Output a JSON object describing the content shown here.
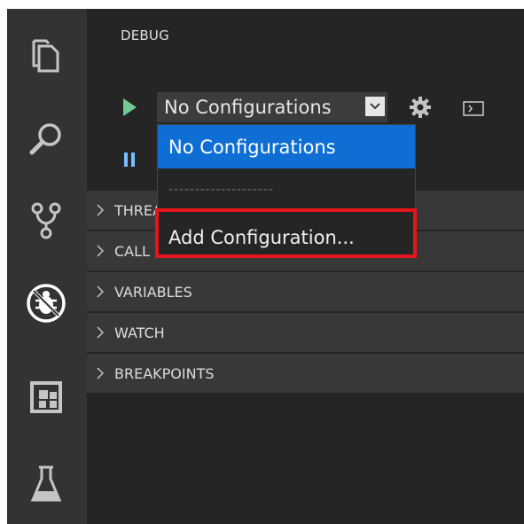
{
  "sidebar": {
    "title": "DEBUG",
    "toolbar": {
      "start_icon": "play-icon",
      "configuration_selected": "No Configurations",
      "settings_icon": "gear-icon",
      "console_icon": "terminal-icon",
      "pause_icon": "pause-icon"
    },
    "sections": [
      {
        "label": "THREADS"
      },
      {
        "label": "CALL STACK"
      },
      {
        "label": "VARIABLES"
      },
      {
        "label": "WATCH"
      },
      {
        "label": "BREAKPOINTS"
      }
    ]
  },
  "dropdown": {
    "options": [
      {
        "label": "No Configurations",
        "selected": true
      },
      {
        "label": "--------------------",
        "separator": true
      },
      {
        "label": "Add Configuration..."
      }
    ]
  },
  "activity_bar": {
    "icons": [
      "files-icon",
      "search-icon",
      "source-control-icon",
      "debug-icon",
      "extensions-icon",
      "flask-icon"
    ]
  },
  "colors": {
    "highlight": "#e8141c",
    "selection": "#0e6ed3",
    "play": "#73c991",
    "pause": "#75beff"
  }
}
